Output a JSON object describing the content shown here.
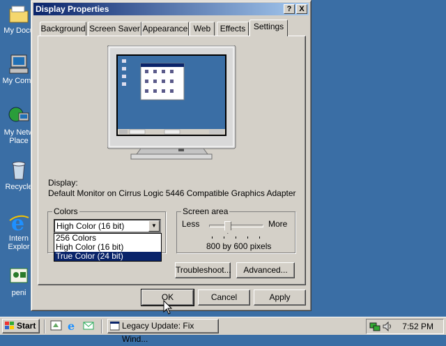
{
  "desktop": {
    "icons": [
      {
        "label": "My Docu",
        "icon": "folder-icon"
      },
      {
        "label": "My Comp",
        "icon": "computer-icon"
      },
      {
        "label": "My Netw",
        "label2": "Place",
        "icon": "network-icon"
      },
      {
        "label": "Recycle",
        "icon": "recycle-bin-icon"
      },
      {
        "label": "Intern",
        "label2": "Explor",
        "icon": "internet-explorer-icon"
      },
      {
        "label": "peni",
        "icon": "program-icon"
      }
    ]
  },
  "window": {
    "title": "Display Properties",
    "help_btn": "?",
    "close_btn": "X",
    "tabs": [
      {
        "label": "Background"
      },
      {
        "label": "Screen Saver"
      },
      {
        "label": "Appearance"
      },
      {
        "label": "Web"
      },
      {
        "label": "Effects"
      },
      {
        "label": "Settings",
        "active": true
      }
    ],
    "display_label": "Display:",
    "display_value": "Default Monitor on Cirrus Logic 5446 Compatible Graphics Adapter",
    "colors": {
      "label": "Colors",
      "selected": "High Color (16 bit)",
      "options": [
        "256 Colors",
        "High Color (16 bit)",
        "True Color (24 bit)"
      ],
      "highlighted": "True Color (24 bit)"
    },
    "screen_area": {
      "label": "Screen area",
      "less": "Less",
      "more": "More",
      "value": "800 by 600 pixels",
      "slider_position": 0.33
    },
    "troubleshoot_btn": "Troubleshoot...",
    "advanced_btn": "Advanced...",
    "ok_btn": "OK",
    "cancel_btn": "Cancel",
    "apply_btn": "Apply"
  },
  "taskbar": {
    "start": "Start",
    "task_label": "Legacy Update: Fix Wind...",
    "clock": "7:52 PM"
  },
  "colors": {
    "desktop": "#3a6ea5",
    "titlebar_start": "#0a246a",
    "titlebar_end": "#a6caf0",
    "face": "#d4d0c8",
    "selection": "#0a246a"
  }
}
